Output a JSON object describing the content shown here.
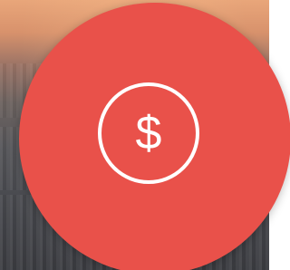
{
  "action": {
    "icon": "dollar-circle-icon",
    "symbol": "$",
    "color": "#e9514a",
    "icon_color": "#ffffff"
  }
}
